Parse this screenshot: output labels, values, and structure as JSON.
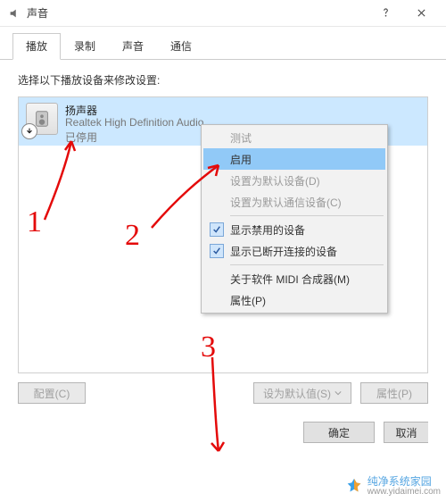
{
  "window": {
    "title": "声音"
  },
  "tabs": {
    "items": [
      {
        "label": "播放",
        "active": true
      },
      {
        "label": "录制",
        "active": false
      },
      {
        "label": "声音",
        "active": false
      },
      {
        "label": "通信",
        "active": false
      }
    ]
  },
  "instruction": "选择以下播放设备来修改设置:",
  "device": {
    "name": "扬声器",
    "driver": "Realtek High Definition Audio",
    "status": "已停用"
  },
  "context_menu": {
    "test": "测试",
    "enable": "启用",
    "set_default": "设置为默认设备(D)",
    "set_default_comm": "设置为默认通信设备(C)",
    "show_disabled": "显示禁用的设备",
    "show_disconnected": "显示已断开连接的设备",
    "about_midi": "关于软件 MIDI 合成器(M)",
    "properties": "属性(P)"
  },
  "buttons": {
    "configure": "配置(C)",
    "set_default_btn": "设为默认值(S)",
    "properties_btn": "属性(P)",
    "ok": "确定",
    "cancel": "取消"
  },
  "annotations": {
    "n1": "1",
    "n2": "2",
    "n3": "3"
  },
  "watermark": {
    "text": "纯净系统家园",
    "url": "www.yidaimei.com"
  }
}
